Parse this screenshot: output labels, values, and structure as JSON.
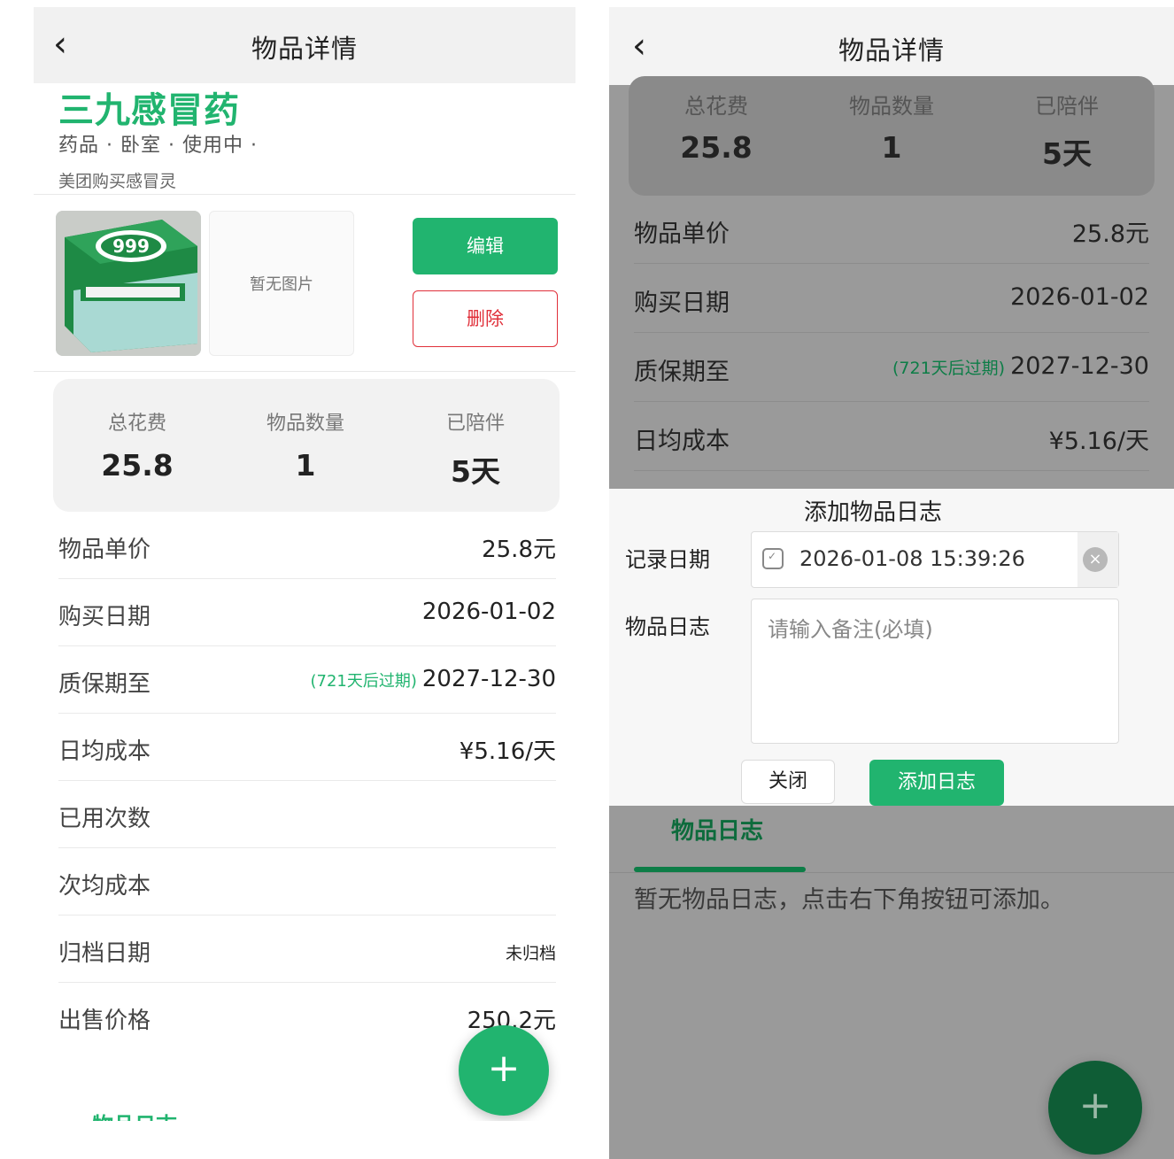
{
  "left": {
    "nav": {
      "back": "‹",
      "title": "物品详情"
    },
    "item": {
      "name": "三九感冒药",
      "meta": "药品 · 卧室 · 使用中 ·",
      "note": "美团购买感冒灵",
      "no_image": "暂无图片"
    },
    "actions": {
      "edit": "编辑",
      "delete": "删除"
    },
    "stats": [
      {
        "label": "总花费",
        "value": "25.8"
      },
      {
        "label": "物品数量",
        "value": "1"
      },
      {
        "label": "已陪伴",
        "value": "5天"
      }
    ],
    "rows": [
      {
        "label": "物品单价",
        "value": "25.8元"
      },
      {
        "label": "购买日期",
        "value": "2026-01-02"
      },
      {
        "label": "质保期至",
        "tag": "(721天后过期)",
        "value": "2027-12-30"
      },
      {
        "label": "日均成本",
        "value": "¥5.16/天"
      },
      {
        "label": "已用次数",
        "value": ""
      },
      {
        "label": "次均成本",
        "value": ""
      },
      {
        "label": "归档日期",
        "value": "未归档"
      },
      {
        "label": "出售价格",
        "value": "250.2元"
      }
    ],
    "fab": "+",
    "cutoff_tab": "物品日志"
  },
  "right": {
    "nav": {
      "back": "‹",
      "title": "物品详情"
    },
    "stats": [
      {
        "label": "总花费",
        "value": "25.8"
      },
      {
        "label": "物品数量",
        "value": "1"
      },
      {
        "label": "已陪伴",
        "value": "5天"
      }
    ],
    "rows": [
      {
        "label": "物品单价",
        "value": "25.8元"
      },
      {
        "label": "购买日期",
        "value": "2026-01-02"
      },
      {
        "label": "质保期至",
        "tag": "(721天后过期)",
        "value": "2027-12-30"
      },
      {
        "label": "日均成本",
        "value": "¥5.16/天"
      }
    ],
    "dialog": {
      "title": "添加物品日志",
      "date_label": "记录日期",
      "date_value": "2026-01-08 15:39:26",
      "log_label": "物品日志",
      "log_placeholder": "请输入备注(必填)",
      "close": "关闭",
      "add": "添加日志"
    },
    "tab": "物品日志",
    "empty": "暂无物品日志，点击右下角按钮可添加。",
    "fab": "+"
  },
  "colors": {
    "accent": "#21b46f",
    "danger": "#e0303a"
  }
}
